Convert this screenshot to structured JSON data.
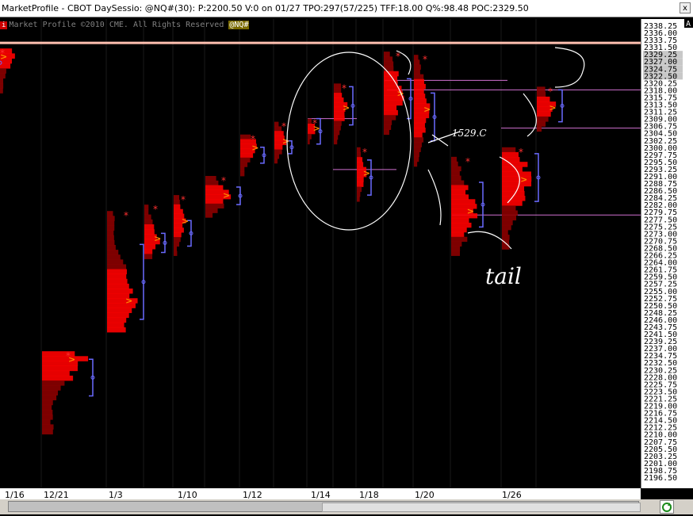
{
  "window": {
    "title": "MarketProfile - CBOT DaySessio: @NQ#(30): P:2200.50 V:0 on 01/27 TPO:297(57/225)  TFF:18.00 Q%:98.48 POC:2329.50",
    "close_label": "x"
  },
  "header": {
    "badge": "i",
    "copyright": "Market Profile ©2010 CME. All Rights Reserved",
    "symbol": "@NQ#",
    "axis_badge": "A"
  },
  "annotations": {
    "tail": "tail",
    "scribble": "1529.C"
  },
  "colors": {
    "background": "#000000",
    "profile_red": "#ff0000",
    "profile_dark": "#8b0000",
    "value_area_bracket": "#6a6aff",
    "poc_marker": "#ff8c00",
    "extreme_marker": "#ff3030",
    "horizontal_line": "#d070d0",
    "handwriting": "#ffffff",
    "highlight_line": "#ffc0b0"
  },
  "chart_data": {
    "type": "market-profile",
    "ylim": [
      2196.5,
      2338.25
    ],
    "y_ticks": [
      "2338.25",
      "2336.00",
      "2333.75",
      "2331.50",
      "2329.25",
      "2327.00",
      "2324.75",
      "2322.50",
      "2320.25",
      "2318.00",
      "2315.75",
      "2313.50",
      "2311.25",
      "2309.00",
      "2306.75",
      "2304.50",
      "2302.25",
      "2300.00",
      "2297.75",
      "2295.50",
      "2293.25",
      "2291.00",
      "2288.75",
      "2286.50",
      "2284.25",
      "2282.00",
      "2279.75",
      "2277.50",
      "2275.25",
      "2273.00",
      "2270.75",
      "2268.50",
      "2266.25",
      "2264.00",
      "2261.75",
      "2259.50",
      "2257.25",
      "2255.00",
      "2252.75",
      "2250.50",
      "2248.25",
      "2246.00",
      "2243.75",
      "2241.50",
      "2239.25",
      "2237.00",
      "2234.75",
      "2232.50",
      "2230.25",
      "2228.00",
      "2225.75",
      "2223.50",
      "2221.25",
      "2219.00",
      "2216.75",
      "2214.50",
      "2212.25",
      "2210.00",
      "2207.75",
      "2205.50",
      "2203.25",
      "2201.00",
      "2198.75",
      "2196.50"
    ],
    "x_labels": [
      "1/16",
      "12/21",
      "1/3",
      "1/10",
      "1/12",
      "1/14",
      "1/18",
      "1/20",
      "1/26"
    ],
    "sessions": [
      {
        "low": 2211,
        "high": 2237,
        "poc": 2234.5,
        "va_low": 2223,
        "va_high": 2234.5,
        "width": 60
      },
      {
        "low": 2243,
        "high": 2281,
        "poc": 2253,
        "va_low": 2247,
        "va_high": 2270.5,
        "width": 42
      },
      {
        "low": 2266,
        "high": 2283,
        "poc": 2272.5,
        "va_low": 2268,
        "va_high": 2274,
        "width": 22
      },
      {
        "low": 2267,
        "high": 2286,
        "poc": 2278,
        "va_low": 2270,
        "va_high": 2278,
        "width": 18
      },
      {
        "low": 2279,
        "high": 2292,
        "poc": 2286,
        "va_low": 2283,
        "va_high": 2288.5,
        "width": 40
      },
      {
        "low": 2292,
        "high": 2305,
        "poc": 2301,
        "va_low": 2296,
        "va_high": 2301,
        "width": 26
      },
      {
        "low": 2296,
        "high": 2309,
        "poc": 2303,
        "va_low": 2299,
        "va_high": 2303,
        "width": 18
      },
      {
        "low": 2302,
        "high": 2310,
        "poc": 2307,
        "va_low": 2302,
        "va_high": 2310,
        "width": 12
      },
      {
        "low": 2302,
        "high": 2321,
        "poc": 2313.5,
        "va_low": 2308,
        "va_high": 2320,
        "width": 20
      },
      {
        "low": 2284,
        "high": 2301,
        "poc": 2293,
        "va_low": 2286,
        "va_high": 2297,
        "width": 14
      },
      {
        "low": 2305,
        "high": 2331,
        "poc": 2318,
        "va_low": 2310,
        "va_high": 2322.5,
        "width": 30
      },
      {
        "low": 2295,
        "high": 2330,
        "poc": 2313,
        "va_low": 2303,
        "va_high": 2318,
        "width": 22
      },
      {
        "low": 2267,
        "high": 2298,
        "poc": 2281,
        "va_low": 2276,
        "va_high": 2290,
        "width": 36
      },
      {
        "low": 2269,
        "high": 2301,
        "poc": 2291,
        "va_low": 2284,
        "va_high": 2299,
        "width": 42
      },
      {
        "low": 2306,
        "high": 2320,
        "poc": 2313.5,
        "va_low": 2309,
        "va_high": 2319,
        "width": 28
      },
      {
        "low": 2318,
        "high": 2332,
        "poc": 2329.5,
        "va_low": 2324,
        "va_high": 2331,
        "width": 20
      }
    ],
    "reference_lines": [
      2333.75,
      2319.0,
      2307.0,
      2279.75
    ],
    "grid": true
  }
}
